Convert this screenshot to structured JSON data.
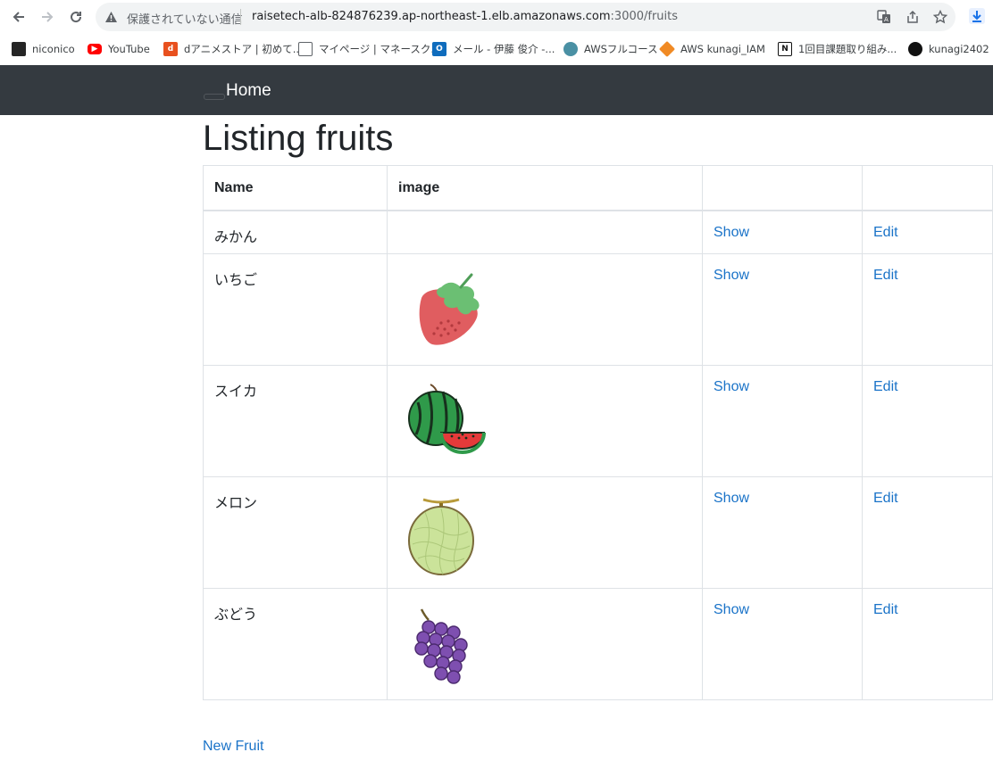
{
  "browser": {
    "security_label": "保護されていない通信",
    "url_host": "raisetech-alb-824876239.ap-northeast-1.elb.amazonaws.com",
    "url_path": ":3000/fruits"
  },
  "bookmarks": [
    {
      "label": "niconico",
      "icon": "niconico-icon",
      "color": "#252525"
    },
    {
      "label": "YouTube",
      "icon": "youtube-icon",
      "color": "#ff0000"
    },
    {
      "label": "dアニメストア | 初めて...",
      "icon": "danime-icon",
      "color": "#e8501e"
    },
    {
      "label": "マイページ | マネースク...",
      "icon": "page-icon",
      "color": "#5f6368"
    },
    {
      "label": "メール - 伊藤 俊介 -...",
      "icon": "outlook-icon",
      "color": "#0f6cbd"
    },
    {
      "label": "AWSフルコース",
      "icon": "aws-course-icon",
      "color": "#4a90a4"
    },
    {
      "label": "AWS kunagi_IAM",
      "icon": "aws-cube-icon",
      "color": "#f08a24"
    },
    {
      "label": "1回目課題取り組み...",
      "icon": "notion-icon",
      "color": "#111111"
    },
    {
      "label": "kunagi2402",
      "icon": "github-icon",
      "color": "#111111"
    }
  ],
  "navbar": {
    "home_label": "Home"
  },
  "page": {
    "title": "Listing fruits",
    "new_fruit_label": "New Fruit"
  },
  "table": {
    "headers": [
      "Name",
      "image",
      "",
      ""
    ],
    "rows": [
      {
        "name": "みかん",
        "image": "",
        "show": "Show",
        "edit": "Edit"
      },
      {
        "name": "いちご",
        "image": "strawberry-image",
        "show": "Show",
        "edit": "Edit"
      },
      {
        "name": "スイカ",
        "image": "watermelon-image",
        "show": "Show",
        "edit": "Edit"
      },
      {
        "name": "メロン",
        "image": "melon-image",
        "show": "Show",
        "edit": "Edit"
      },
      {
        "name": "ぶどう",
        "image": "grape-image",
        "show": "Show",
        "edit": "Edit"
      }
    ]
  },
  "colors": {
    "navbar_bg": "#343a40",
    "link": "#1a73c8",
    "border": "#dee2e6"
  }
}
